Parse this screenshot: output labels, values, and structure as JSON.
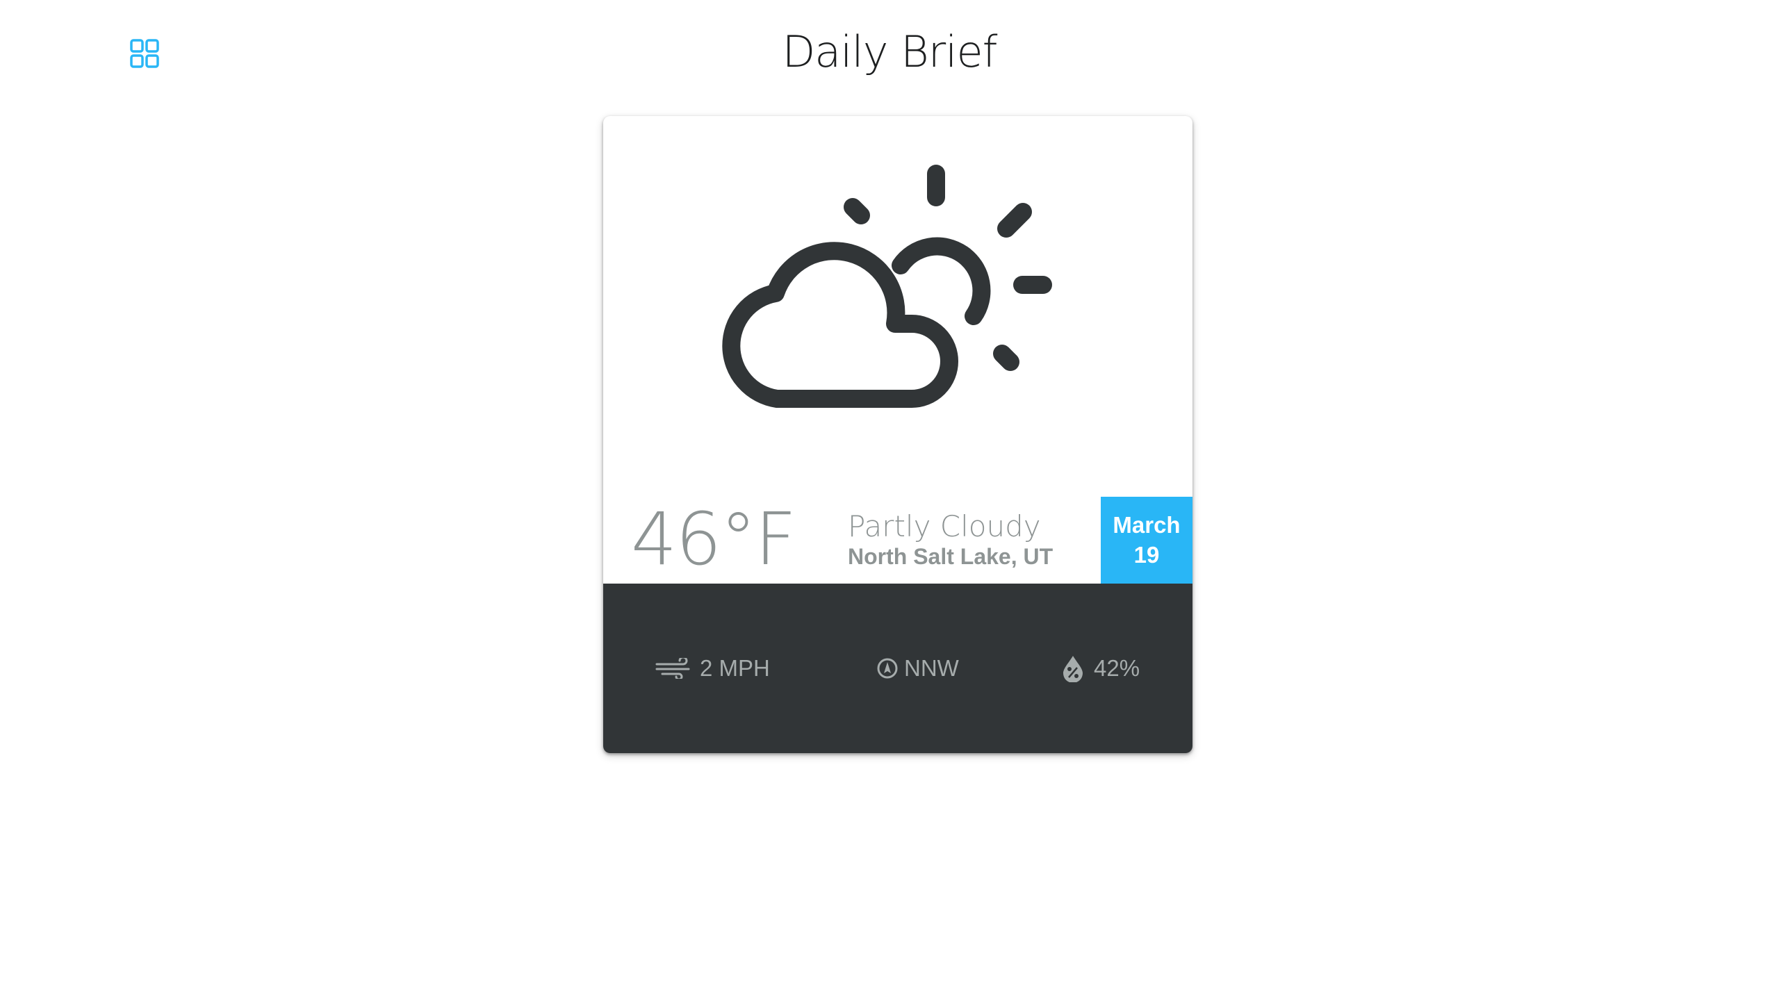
{
  "header": {
    "title": "Daily Brief",
    "menu_icon": "grid-icon",
    "accent_color": "#29b6f6"
  },
  "weather_card": {
    "illustration_icon": "partly-cloudy-icon",
    "temperature": "46°F",
    "condition": "Partly Cloudy",
    "location": "North Salt Lake, UT",
    "date": {
      "month": "March",
      "day": "19"
    },
    "stats": {
      "wind_speed": "2 MPH",
      "wind_speed_icon": "wind-icon",
      "wind_direction": "NNW",
      "wind_direction_icon": "compass-icon",
      "humidity": "42%",
      "humidity_icon": "humidity-drop-icon"
    },
    "colors": {
      "stats_bar": "#313537",
      "date_badge": "#29b6f6",
      "text_muted": "#8e9494"
    }
  }
}
